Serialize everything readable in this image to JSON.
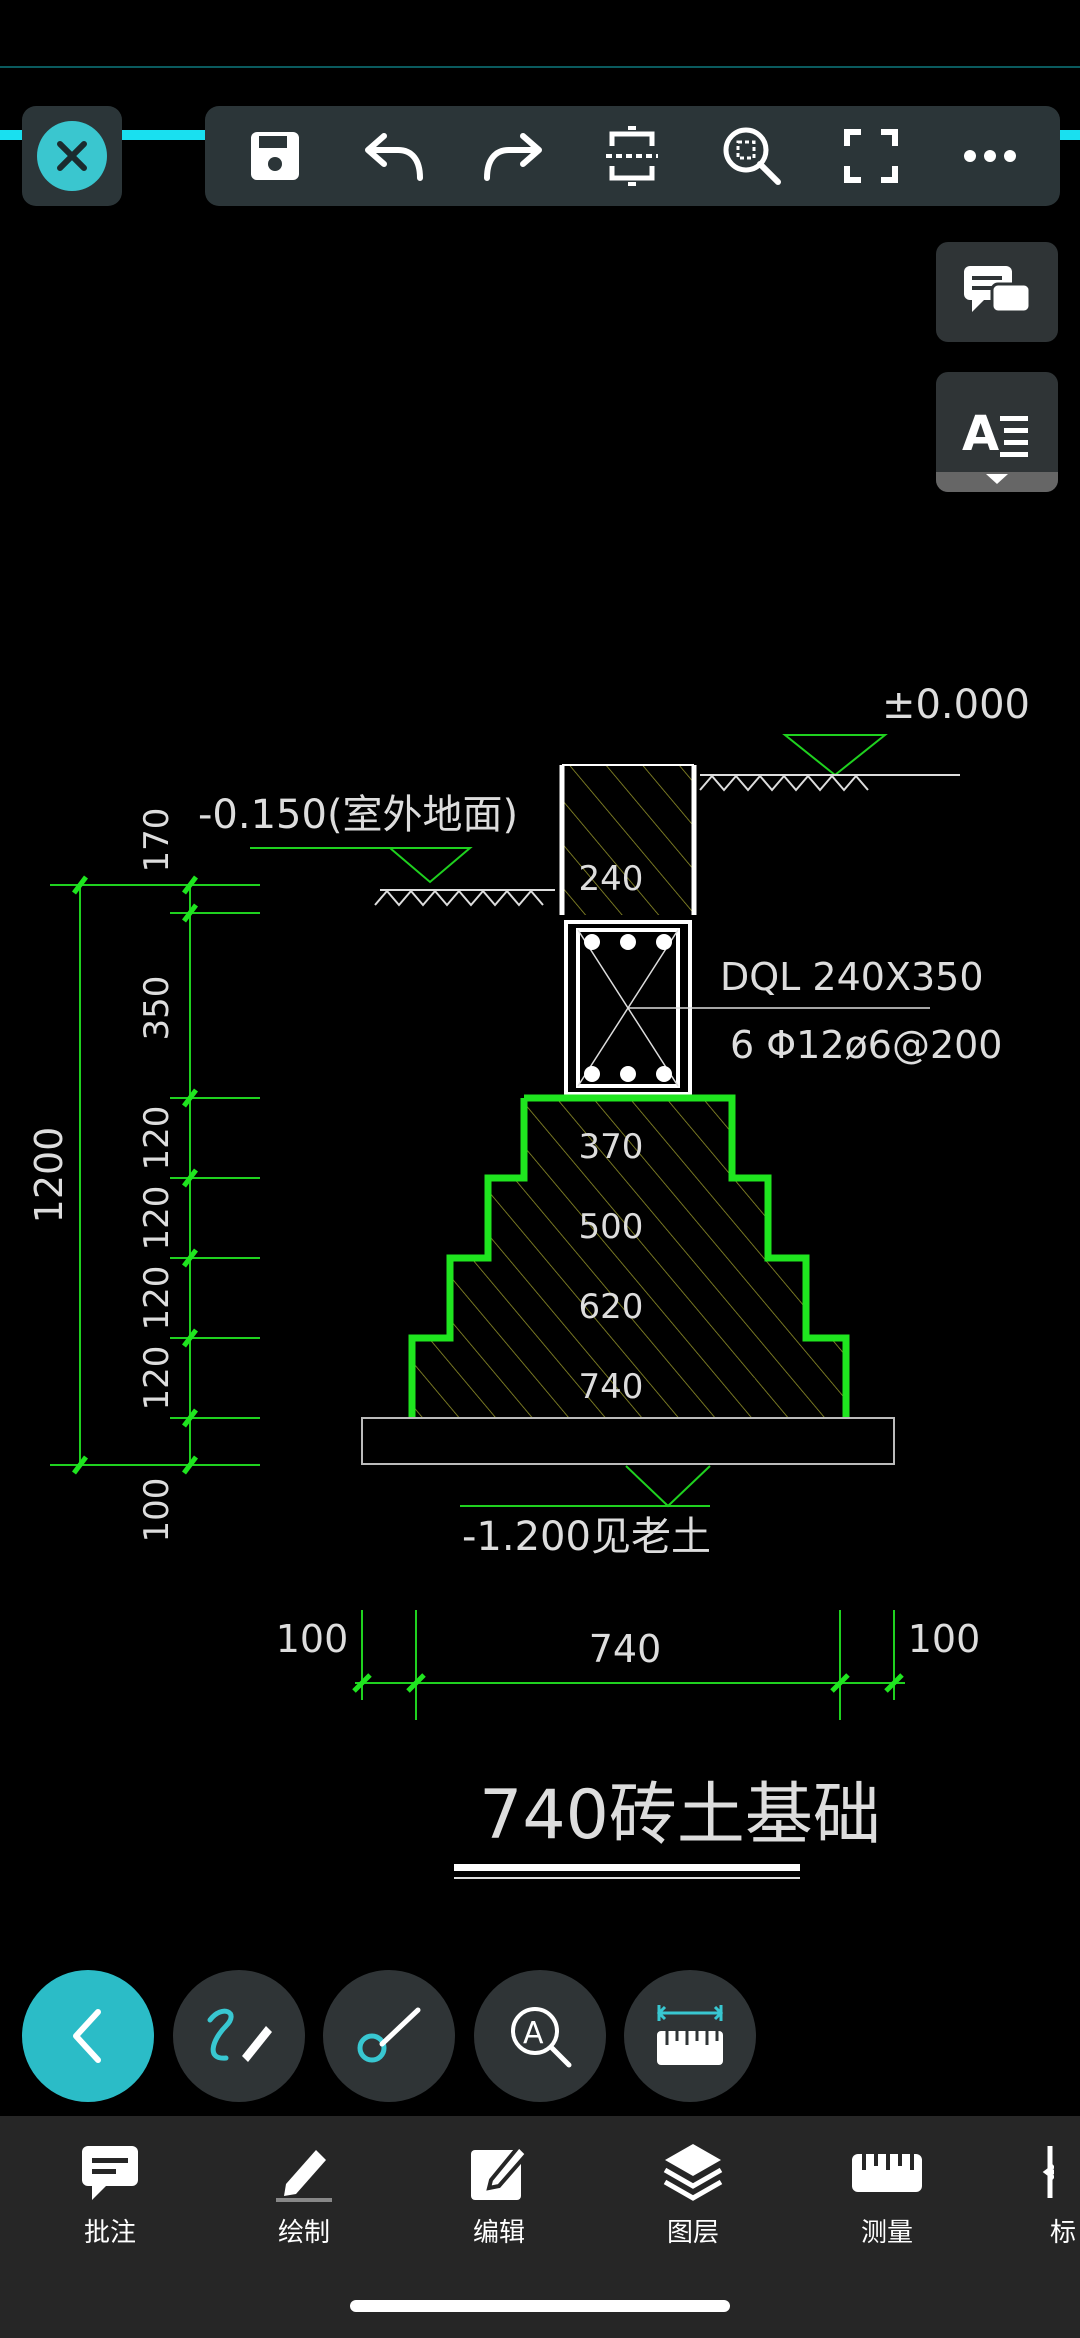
{
  "toolbar": {
    "close": "close",
    "icons": [
      "save-icon",
      "undo-icon",
      "redo-icon",
      "section-icon",
      "zoom-window-icon",
      "fullscreen-icon",
      "more-icon"
    ]
  },
  "side_buttons": [
    "comments-icon",
    "text-style-icon"
  ],
  "drawing": {
    "title": "740砖土基础",
    "elev_top": "±0.000",
    "elev_outdoor": "-0.150(室外地面)",
    "elev_bottom": "-1.200见老土",
    "beam_label": "DQL 240X350",
    "rebar_label": "6 Φ12ø6@200",
    "wall_width": "240",
    "step_widths": [
      "370",
      "500",
      "620",
      "740"
    ],
    "dim_left_vertical": [
      "170",
      "350",
      "120",
      "120",
      "120",
      "120",
      "100"
    ],
    "dim_total": "1200",
    "dim_bottom": [
      "100",
      "740",
      "100"
    ]
  },
  "circle_tools": [
    "back-icon",
    "freehand-draw-icon",
    "brush-icon",
    "text-search-icon",
    "ruler-measure-icon"
  ],
  "bottom_nav": [
    {
      "label": "批注",
      "icon": "comment-icon"
    },
    {
      "label": "绘制",
      "icon": "pencil-icon"
    },
    {
      "label": "编辑",
      "icon": "edit-icon"
    },
    {
      "label": "图层",
      "icon": "layers-icon"
    },
    {
      "label": "测量",
      "icon": "measure-icon"
    },
    {
      "label": "标",
      "icon": "dimension-icon"
    }
  ]
}
